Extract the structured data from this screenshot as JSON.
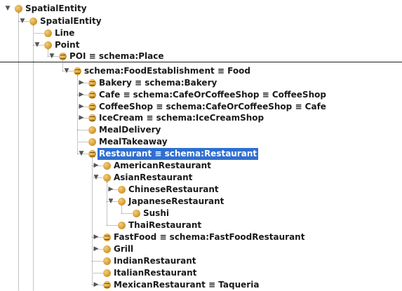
{
  "tree": {
    "nodes": [
      {
        "label": "SpatialEntity",
        "expanded": true,
        "equivalent": false
      },
      {
        "label": "SpatialEntity",
        "expanded": true,
        "equivalent": false
      },
      {
        "label": "Line",
        "expanded": null,
        "equivalent": false
      },
      {
        "label": "Point",
        "expanded": true,
        "equivalent": false
      },
      {
        "label": "POI ≡ schema:Place",
        "expanded": true,
        "equivalent": true
      },
      {
        "label": "schema:FoodEstablishment ≡ Food",
        "expanded": true,
        "equivalent": true
      },
      {
        "label": "Bakery ≡ schema:Bakery",
        "expanded": false,
        "equivalent": true
      },
      {
        "label": "Cafe ≡ schema:CafeOrCoffeeShop ≡ CoffeeShop",
        "expanded": false,
        "equivalent": true
      },
      {
        "label": "CoffeeShop ≡ schema:CafeOrCoffeeShop ≡ Cafe",
        "expanded": false,
        "equivalent": true
      },
      {
        "label": "IceCream ≡ schema:IceCreamShop",
        "expanded": false,
        "equivalent": true
      },
      {
        "label": "MealDelivery",
        "expanded": null,
        "equivalent": false
      },
      {
        "label": "MealTakeaway",
        "expanded": null,
        "equivalent": false
      },
      {
        "label": "Restaurant ≡ schema:Restaurant",
        "expanded": true,
        "equivalent": true,
        "selected": true
      },
      {
        "label": "AmericanRestaurant",
        "expanded": false,
        "equivalent": false
      },
      {
        "label": "AsianRestaurant",
        "expanded": true,
        "equivalent": false
      },
      {
        "label": "ChineseRestaurant",
        "expanded": false,
        "equivalent": false
      },
      {
        "label": "JapaneseRestaurant",
        "expanded": true,
        "equivalent": false
      },
      {
        "label": "Sushi",
        "expanded": null,
        "equivalent": false
      },
      {
        "label": "ThaiRestaurant",
        "expanded": null,
        "equivalent": false
      },
      {
        "label": "FastFood ≡ schema:FastFoodRestaurant",
        "expanded": false,
        "equivalent": true
      },
      {
        "label": "Grill",
        "expanded": false,
        "equivalent": false
      },
      {
        "label": "IndianRestaurant",
        "expanded": null,
        "equivalent": false
      },
      {
        "label": "ItalianRestaurant",
        "expanded": null,
        "equivalent": false
      },
      {
        "label": "MexicanRestaurant ≡ Taqueria",
        "expanded": false,
        "equivalent": true
      }
    ]
  },
  "colors": {
    "class_icon": "#d9a23b",
    "selection": "#2f6fd0",
    "connector": "#8a8a8a"
  }
}
